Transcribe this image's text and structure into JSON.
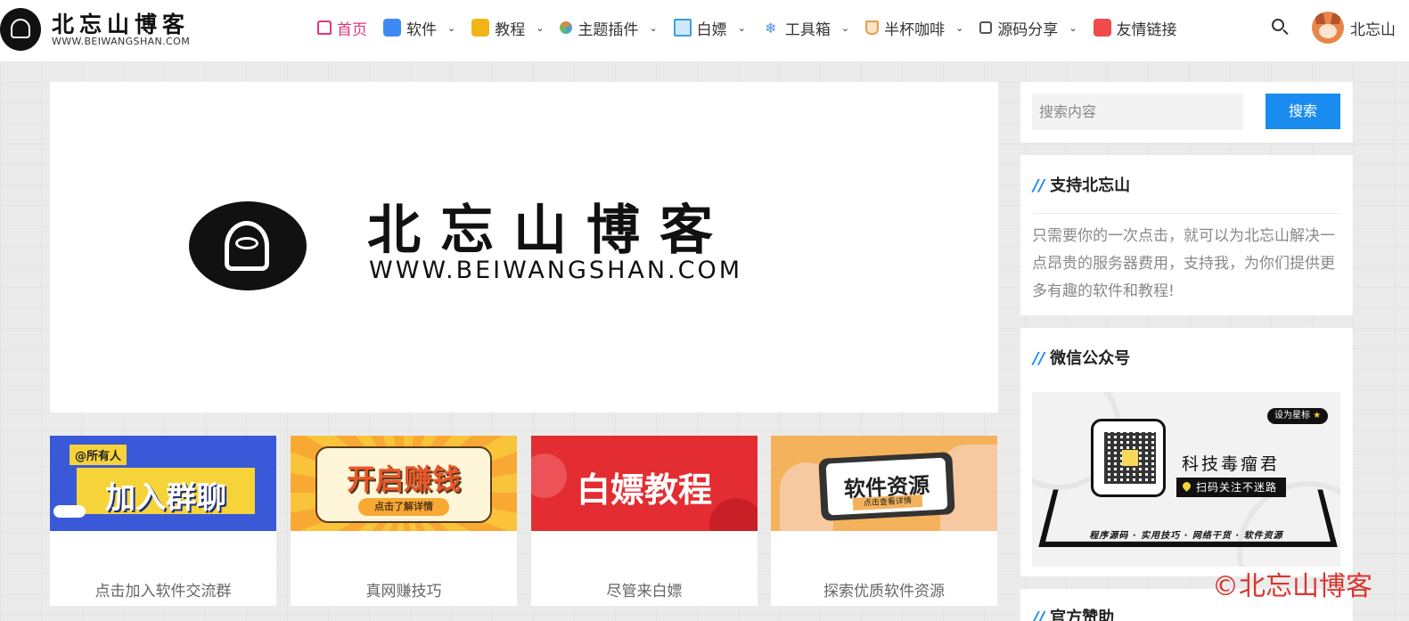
{
  "header": {
    "logo_title": "北忘山博客",
    "logo_url": "WWW.BEIWANGSHAN.COM",
    "nav": [
      {
        "label": "首页",
        "icon": "home-icon",
        "color": "#e0357a",
        "active": true
      },
      {
        "label": "软件",
        "icon": "apps-icon",
        "color": "#3d8bf2"
      },
      {
        "label": "教程",
        "icon": "book-icon",
        "color": "#f2b517"
      },
      {
        "label": "主题插件",
        "icon": "palette-icon",
        "color": "#f0833a"
      },
      {
        "label": "白嫖",
        "icon": "monitor-icon",
        "color": "#3aa0e0"
      },
      {
        "label": "工具箱",
        "icon": "network-icon",
        "color": "#4f8fe0"
      },
      {
        "label": "半杯咖啡",
        "icon": "coffee-icon",
        "color": "#e0a050"
      },
      {
        "label": "源码分享",
        "icon": "code-icon",
        "color": "#555555"
      },
      {
        "label": "友情链接",
        "icon": "link-icon",
        "color": "#f04a4a"
      }
    ],
    "user_name": "北忘山"
  },
  "banner": {
    "title": "北忘山博客",
    "url": "WWW.BEIWANGSHAN.COM"
  },
  "cards": [
    {
      "image_tag": "@所有人",
      "image_text": "加入群聊",
      "caption": "点击加入软件交流群"
    },
    {
      "image_text": "开启赚钱",
      "image_button": "点击了解详情",
      "caption": "真网赚技巧"
    },
    {
      "image_text": "白嫖教程",
      "caption": "尽管来白嫖"
    },
    {
      "image_text": "软件资源",
      "image_button": "点击查看详情",
      "caption": "探索优质软件资源"
    }
  ],
  "sidebar": {
    "search_placeholder": "搜索内容",
    "search_button": "搜索",
    "support": {
      "title": "支持北忘山",
      "slash": "//",
      "text": "只需要你的一次点击，就可以为北忘山解决一点昂贵的服务器费用，支持我，为你们提供更多有趣的软件和教程!"
    },
    "wechat": {
      "title": "微信公众号",
      "slash": "//",
      "name": "科技毒瘤君",
      "scan_text": "扫码关注不迷路",
      "star_text": "设为星标",
      "star_glyph": "★",
      "footer": "程序源码 · 实用技巧 · 网络干货 · 软件资源"
    },
    "next_widget_title": "官方赞助"
  },
  "watermark": "©北忘山博客"
}
